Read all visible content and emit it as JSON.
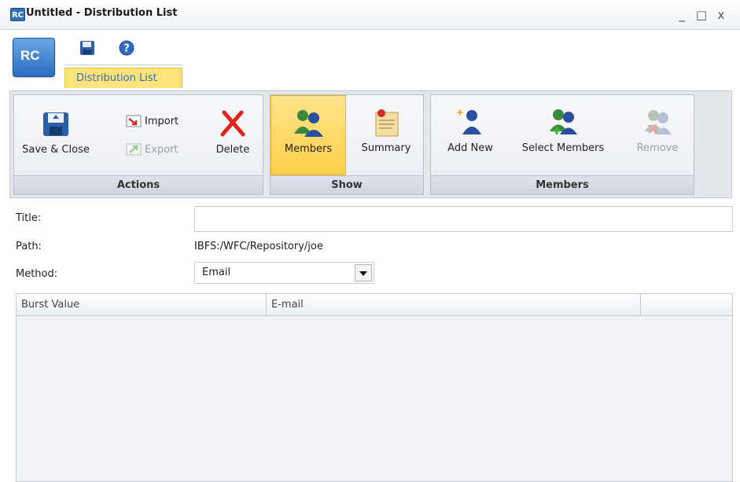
{
  "window": {
    "app_badge": "RC",
    "title": "Untitled - Distribution List",
    "minimize_label": "_",
    "maximize_label": "□",
    "close_label": "x"
  },
  "app_logo": "RC",
  "ribbon_tab": "Distribution List",
  "actions": {
    "save_close": "Save & Close",
    "import": "Import",
    "export": "Export",
    "delete": "Delete",
    "group_label": "Actions"
  },
  "show": {
    "members": "Members",
    "summary": "Summary",
    "group_label": "Show"
  },
  "members_group": {
    "add_new": "Add New",
    "select_members": "Select Members",
    "remove": "Remove",
    "group_label": "Members"
  },
  "form": {
    "title_label": "Title:",
    "title_value": "",
    "path_label": "Path:",
    "path_value": "IBFS:/WFC/Repository/joe",
    "method_label": "Method:",
    "method_value": "Email"
  },
  "grid": {
    "columns": [
      "Burst Value",
      "E-mail",
      ""
    ]
  },
  "colors": {
    "accent": "#2f6fb3",
    "selected": "#ffcf4a"
  }
}
